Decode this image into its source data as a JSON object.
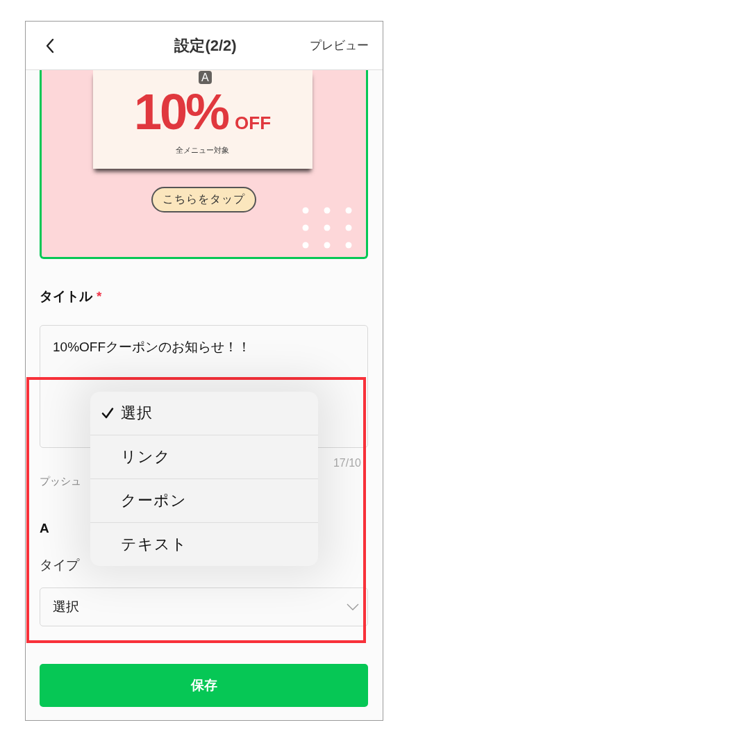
{
  "header": {
    "title": "設定(2/2)",
    "action": "プレビュー"
  },
  "banner": {
    "area_label": "A",
    "selected": true,
    "discount": "10%",
    "discount_suffix": "OFF",
    "note": "全メニュー対象",
    "button": "こちらをタップ"
  },
  "title_field": {
    "label": "タイトル",
    "required_mark": "*",
    "value": "10%OFFクーポンのお知らせ！！",
    "counter": "17/10"
  },
  "push_hint": "プッシュ",
  "action_section": {
    "heading": "A",
    "type_label": "タイプ",
    "select_value": "選択"
  },
  "dropdown": {
    "options": [
      {
        "label": "選択",
        "selected": true
      },
      {
        "label": "リンク",
        "selected": false
      },
      {
        "label": "クーポン",
        "selected": false
      },
      {
        "label": "テキスト",
        "selected": false
      }
    ]
  },
  "save_button": "保存"
}
